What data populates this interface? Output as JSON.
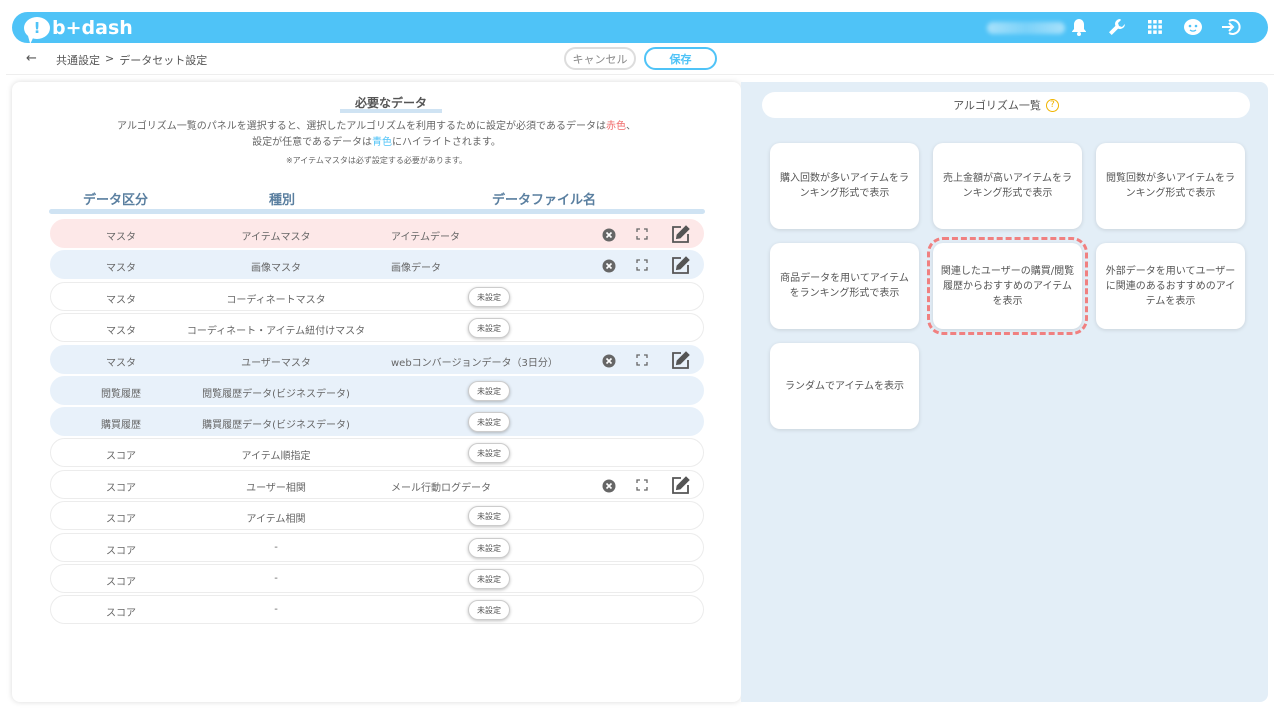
{
  "header": {
    "logo_text": "b+dash",
    "icons": [
      "bell-icon",
      "wrench-icon",
      "grid-icon",
      "support-icon",
      "logout-icon"
    ]
  },
  "subbar": {
    "back": "←",
    "breadcrumb": [
      "共通設定",
      ">",
      "データセット設定"
    ],
    "cancel": "キャンセル",
    "save": "保存"
  },
  "required": {
    "title": "必要なデータ",
    "desc1_a": "アルゴリズム一覧のパネルを選択すると、選択したアルゴリズムを利用するために設定が必須であるデータは",
    "desc1_red": "赤色",
    "desc1_b": "、",
    "desc2_a": "設定が任意であるデータは",
    "desc2_blue": "青色",
    "desc2_b": "にハイライトされます。",
    "note": "※アイテムマスタは必ず設定する必要があります。",
    "headers": [
      "データ区分",
      "種別",
      "データファイル名"
    ],
    "unset_label": "未設定",
    "rows": [
      {
        "cat": "マスタ",
        "type": "アイテムマスタ",
        "file": "アイテムデータ"
      },
      {
        "cat": "マスタ",
        "type": "画像マスタ",
        "file": "画像データ"
      },
      {
        "cat": "マスタ",
        "type": "コーディネートマスタ",
        "file": ""
      },
      {
        "cat": "マスタ",
        "type": "コーディネート・アイテム紐付けマスタ",
        "file": ""
      },
      {
        "cat": "マスタ",
        "type": "ユーザーマスタ",
        "file": "webコンバージョンデータ（3日分）"
      },
      {
        "cat": "閲覧履歴",
        "type": "閲覧履歴データ(ビジネスデータ)",
        "file": ""
      },
      {
        "cat": "購買履歴",
        "type": "購買履歴データ(ビジネスデータ)",
        "file": ""
      },
      {
        "cat": "スコア",
        "type": "アイテム順指定",
        "file": ""
      },
      {
        "cat": "スコア",
        "type": "ユーザー相関",
        "file": "メール行動ログデータ"
      },
      {
        "cat": "スコア",
        "type": "アイテム相関",
        "file": ""
      },
      {
        "cat": "スコア",
        "type": "-",
        "file": ""
      },
      {
        "cat": "スコア",
        "type": "-",
        "file": ""
      },
      {
        "cat": "スコア",
        "type": "-",
        "file": ""
      }
    ]
  },
  "algorithms": {
    "title": "アルゴリズム一覧",
    "help": "?",
    "cards": [
      "購入回数が多いアイテムをランキング形式で表示",
      "売上金額が高いアイテムをランキング形式で表示",
      "閲覧回数が多いアイテムをランキング形式で表示",
      "商品データを用いてアイテムをランキング形式で表示",
      "関連したユーザーの購買/閲覧履歴からおすすめのアイテムを表示",
      "外部データを用いてユーザーに関連のあるおすすめのアイテムを表示",
      "ランダムでアイテムを表示"
    ]
  },
  "colors": {
    "accent": "#4fc3f7",
    "required": "#fde8e8",
    "optional": "#e8f1fa",
    "highlight": "#f08080"
  }
}
